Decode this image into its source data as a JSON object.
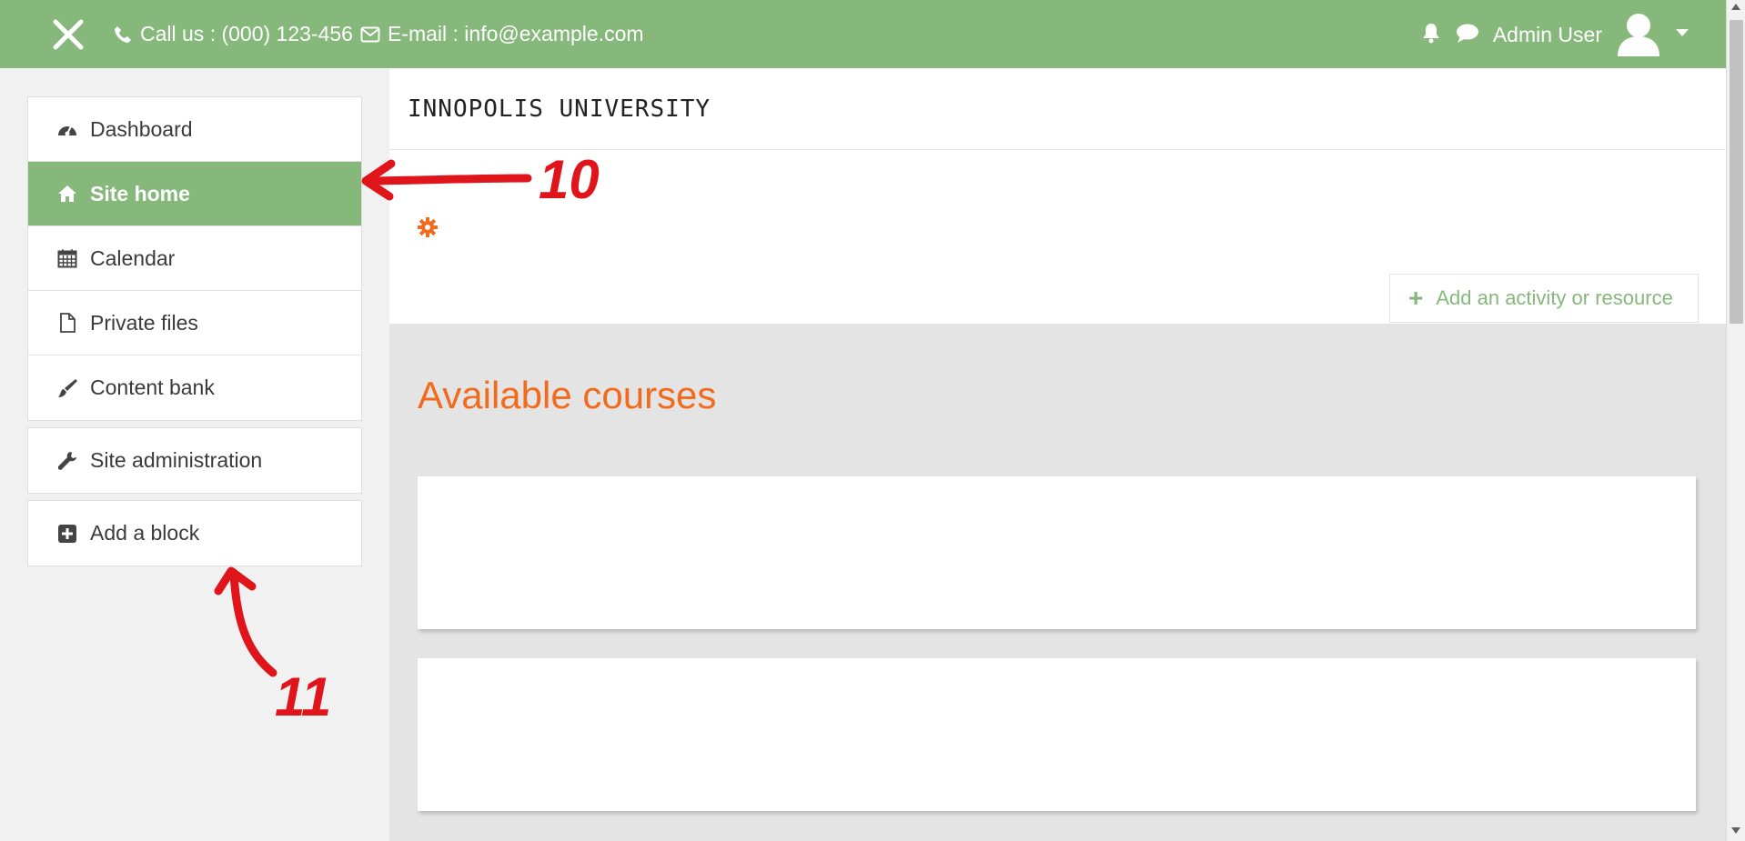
{
  "topbar": {
    "phone_label": "Call us : (000) 123-456",
    "email_label": "E-mail : info@example.com",
    "user_name": "Admin User",
    "bg_color": "#86b87b"
  },
  "sidebar": {
    "items": [
      {
        "label": "Dashboard",
        "icon": "dashboard-icon"
      },
      {
        "label": "Site home",
        "icon": "home-icon",
        "active": true
      },
      {
        "label": "Calendar",
        "icon": "calendar-icon"
      },
      {
        "label": "Private files",
        "icon": "file-icon"
      },
      {
        "label": "Content bank",
        "icon": "paintbrush-icon"
      }
    ],
    "site_admin_label": "Site administration",
    "add_block_label": "Add a block"
  },
  "main": {
    "logo_text": "INNOPOLIS UNIVERSITY",
    "add_activity_label": "Add an activity or resource",
    "courses_heading": "Available courses",
    "heading_color": "#f26a1b"
  },
  "annotations": {
    "label_10": "10",
    "label_11": "11"
  }
}
